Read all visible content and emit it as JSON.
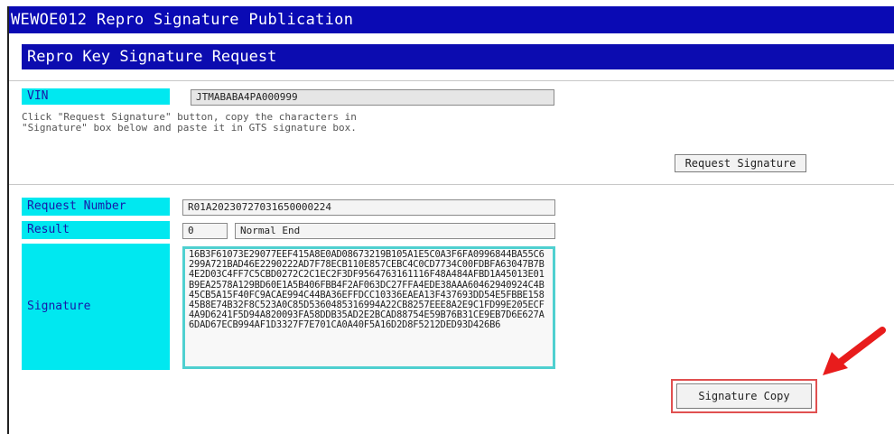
{
  "window": {
    "title": "WEWOE012 Repro Signature Publication"
  },
  "section": {
    "title": "Repro Key Signature Request"
  },
  "vin": {
    "label": "VIN",
    "value": "JTMABABA4PA000999"
  },
  "instructions": {
    "line1": "Click \"Request Signature\" button, copy the characters in",
    "line2": "\"Signature\" box below and paste it in GTS signature box."
  },
  "buttons": {
    "request_signature": "Request Signature",
    "signature_copy": "Signature Copy"
  },
  "request_number": {
    "label": "Request Number",
    "value": "R01A20230727031650000224"
  },
  "result": {
    "label": "Result",
    "code": "0",
    "text": "Normal End"
  },
  "signature": {
    "label": "Signature",
    "value": "16B3F61073E29077EEF415A8E0AD08673219B105A1E5C0A3F6FA0996844BA55C6299A721BAD46E2290222AD7F78ECB110E857CEBC4C0CD7734C00FDBFA63047B7B4E2D03C4FF7C5CBD0272C2C1EC2F3DF9564763161116F48A484AFBD1A45013E01B9EA2578A129BD60E1A5B406FBB4F2AF063DC27FFA4EDE38AAA60462940924C4B45CB5A15F40FC9ACAE994C44BA36EFFDCC10336EAEA13F437693DD54E5FBBE15845B8E74B32F8C523A0C85D5360485316994A22CB8257EEE8A2E9C1FD99E205ECF4A9D6241F5D94A820093FA58DDB35AD2E2BCAD88754E59B76B31CE9EB7D6E627A6DAD67ECB994AF1D3327F7E701CA0A40F5A16D2D8F5212DED93D426B6"
  },
  "colors": {
    "title_bg": "#0a0ab4",
    "label_bg": "#00e8f0",
    "highlight": "#e05050",
    "arrow": "#e81c1c"
  },
  "icons": {
    "annotation": "red-arrow-icon"
  }
}
